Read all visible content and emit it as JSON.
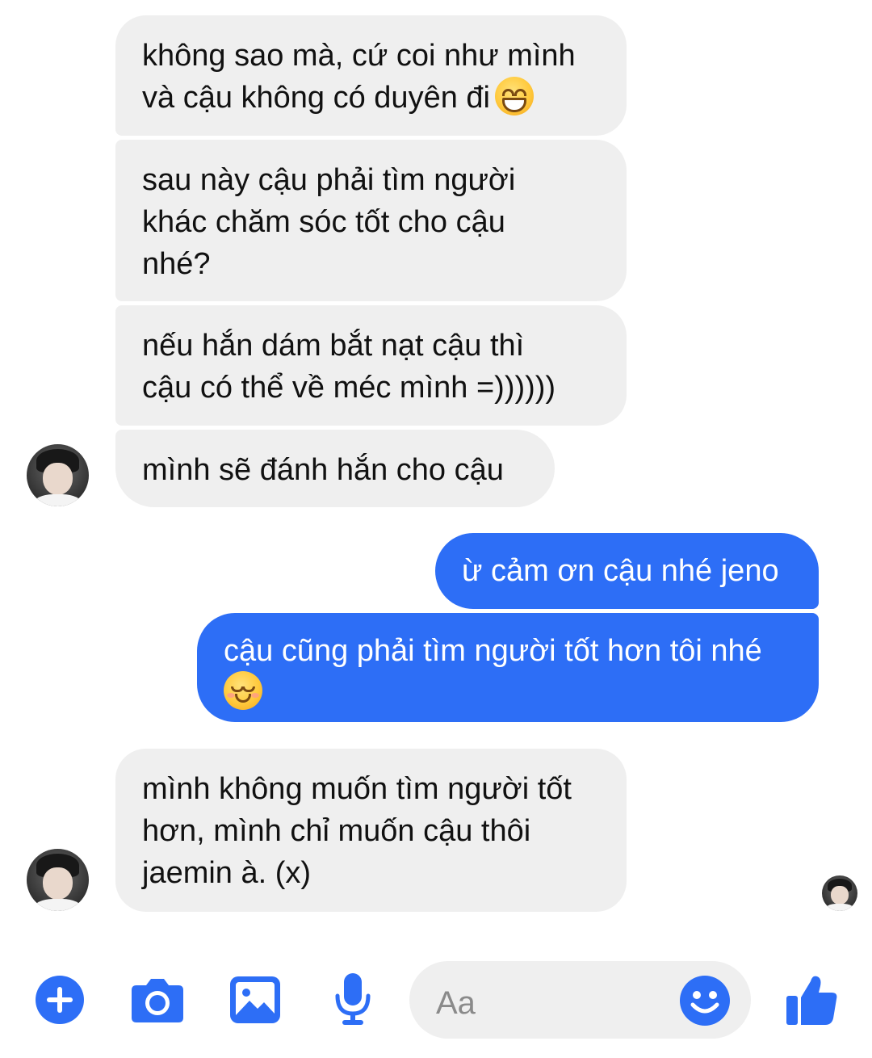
{
  "colors": {
    "accent": "#2d6ef6",
    "incoming_bubble": "#efefef",
    "background": "#ffffff"
  },
  "messages": [
    {
      "side": "incoming",
      "lines": [
        "không sao mà, cứ coi như mình",
        "và cậu không có duyên đi"
      ],
      "emoji": "grinning-face-emoji"
    },
    {
      "side": "incoming",
      "lines": [
        "sau này cậu phải tìm người",
        "khác chăm sóc tốt cho cậu",
        "nhé?"
      ]
    },
    {
      "side": "incoming",
      "lines": [
        "nếu hắn dám bắt nạt cậu thì",
        "cậu có thể về méc mình =))))))"
      ]
    },
    {
      "side": "incoming",
      "lines": [
        "mình sẽ đánh hắn cho cậu"
      ],
      "avatar": true
    },
    {
      "side": "outgoing",
      "lines": [
        "ừ cảm ơn cậu nhé jeno"
      ]
    },
    {
      "side": "outgoing",
      "lines": [
        "cậu cũng phải tìm người tốt hơn tôi nhé"
      ],
      "emoji": "smiling-face-emoji"
    },
    {
      "side": "incoming",
      "lines": [
        "mình không muốn tìm người tốt",
        "hơn, mình chỉ muốn cậu thôi",
        "jaemin à. (x)"
      ],
      "avatar": true
    }
  ],
  "read_receipt": {
    "icon": "seen-avatar-icon"
  },
  "composer": {
    "placeholder": "Aa",
    "icons": [
      "plus-icon",
      "camera-icon",
      "image-icon",
      "microphone-icon",
      "emoji-icon",
      "like-icon"
    ]
  }
}
